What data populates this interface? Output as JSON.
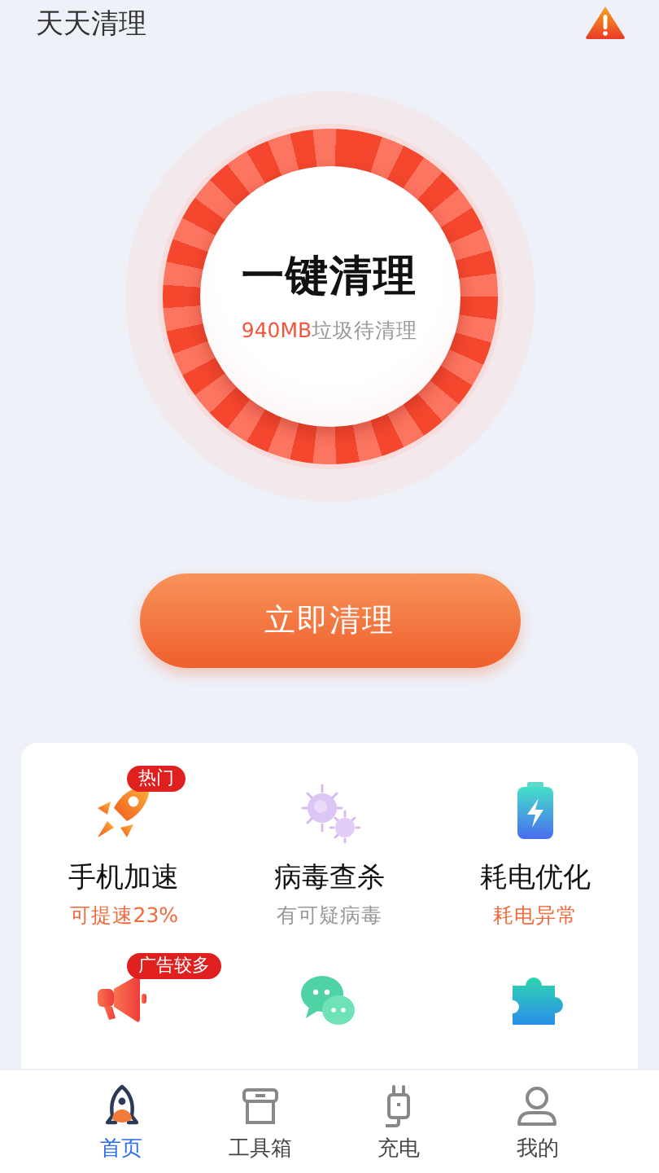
{
  "app_title": "天天清理",
  "dial": {
    "title": "一键清理",
    "junk_size": "940MB",
    "junk_label": "垃圾待清理"
  },
  "clean_button": "立即清理",
  "features": [
    {
      "kind": "tile",
      "label": "手机加速",
      "badge": "热门",
      "status": "可提速23%",
      "alert": true
    },
    {
      "kind": "tile",
      "label": "病毒查杀",
      "status": "有可疑病毒",
      "alert": false
    },
    {
      "kind": "tile",
      "label": "耗电优化",
      "status": "耗电异常",
      "alert": true
    },
    {
      "kind": "tile",
      "badge": "广告较多"
    },
    {
      "kind": "tile"
    },
    {
      "kind": "tile"
    }
  ],
  "tabs": [
    {
      "label": "首页",
      "selected": true
    },
    {
      "label": "工具箱",
      "selected": false
    },
    {
      "label": "充电",
      "selected": false
    },
    {
      "label": "我的",
      "selected": false
    }
  ]
}
